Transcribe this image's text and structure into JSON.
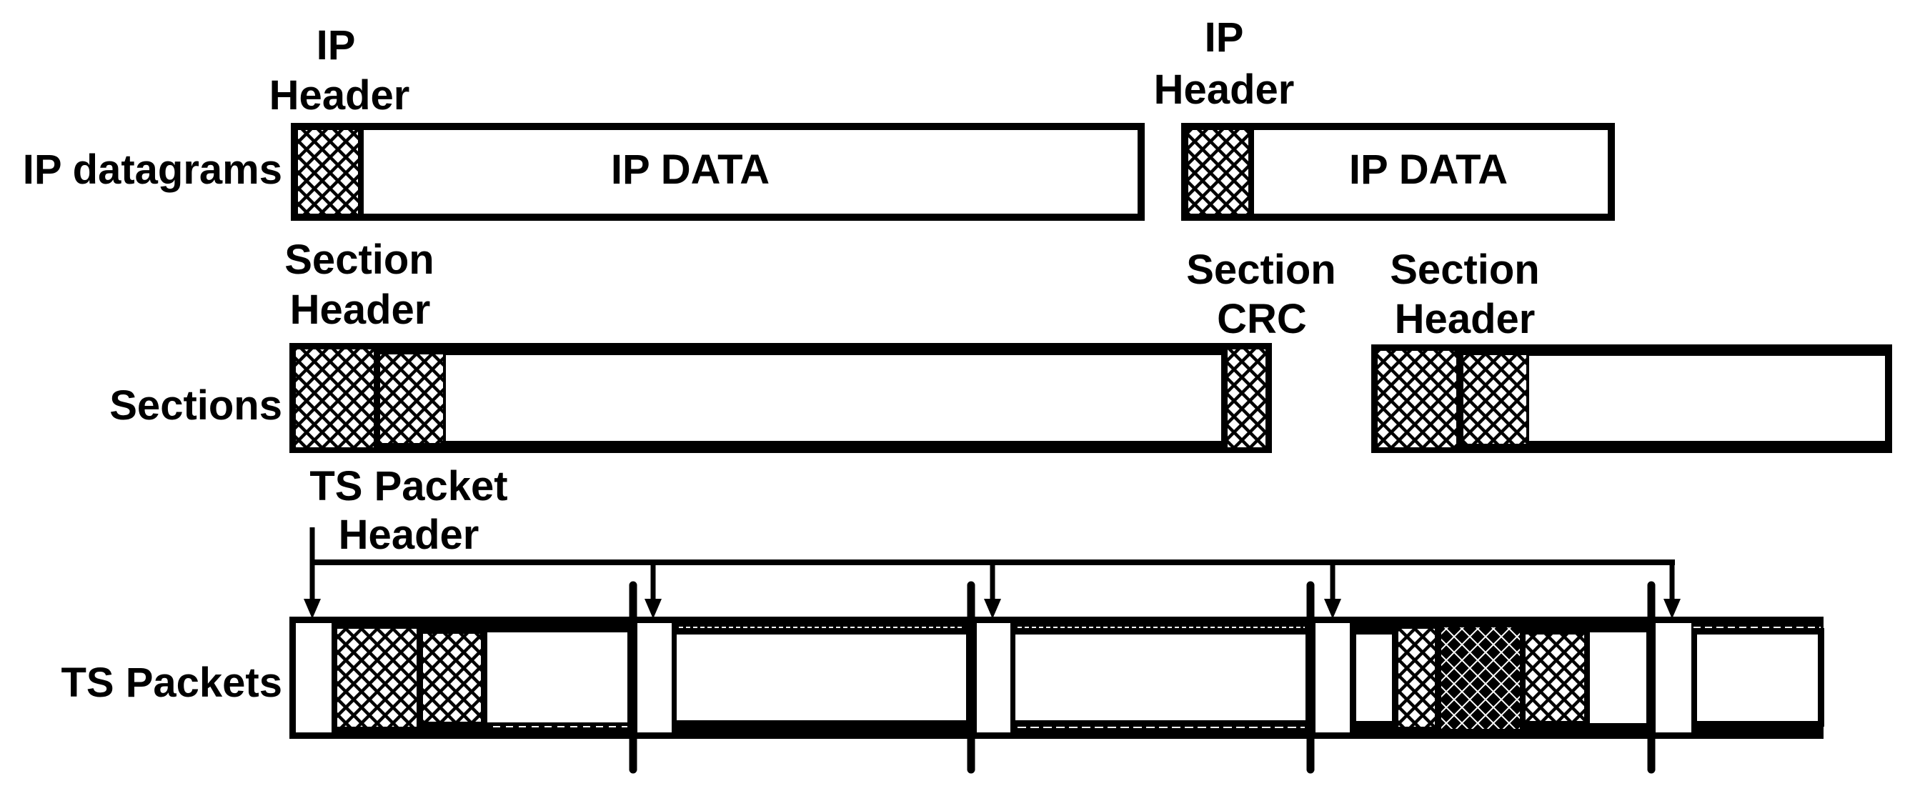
{
  "figure": {
    "rows": {
      "ip": "IP datagrams",
      "sections": "Sections",
      "ts": "TS Packets"
    },
    "annotations": {
      "ip_header_1": [
        "IP",
        "Header"
      ],
      "ip_header_2": [
        "IP",
        "Header"
      ],
      "section_header_1": [
        "Section",
        "Header"
      ],
      "section_crc": [
        "Section",
        "CRC"
      ],
      "section_header_2": [
        "Section",
        "Header"
      ],
      "ts_packet_header": [
        "TS Packet",
        "Header"
      ]
    },
    "ip_datagrams": [
      {
        "header": "hatched",
        "payload_label": "IP DATA"
      },
      {
        "header": "hatched",
        "payload_label": "IP DATA"
      }
    ],
    "sections": [
      {
        "parts": [
          "section-header",
          "ip-header",
          "payload",
          "section-crc"
        ]
      },
      {
        "parts": [
          "section-header",
          "ip-header",
          "payload"
        ]
      }
    ],
    "ts_packets": [
      {
        "parts": [
          "ts-header",
          "section-header",
          "ip-header",
          "payload",
          "stuffing"
        ]
      },
      {
        "parts": [
          "ts-header",
          "payload"
        ]
      },
      {
        "parts": [
          "ts-header",
          "payload"
        ]
      },
      {
        "parts": [
          "ts-header",
          "payload-end",
          "section-crc",
          "section-header",
          "ip-header",
          "payload"
        ]
      },
      {
        "parts": [
          "ts-header",
          "payload"
        ]
      }
    ],
    "colors": {
      "ink": "#000000",
      "paper": "#ffffff"
    }
  }
}
